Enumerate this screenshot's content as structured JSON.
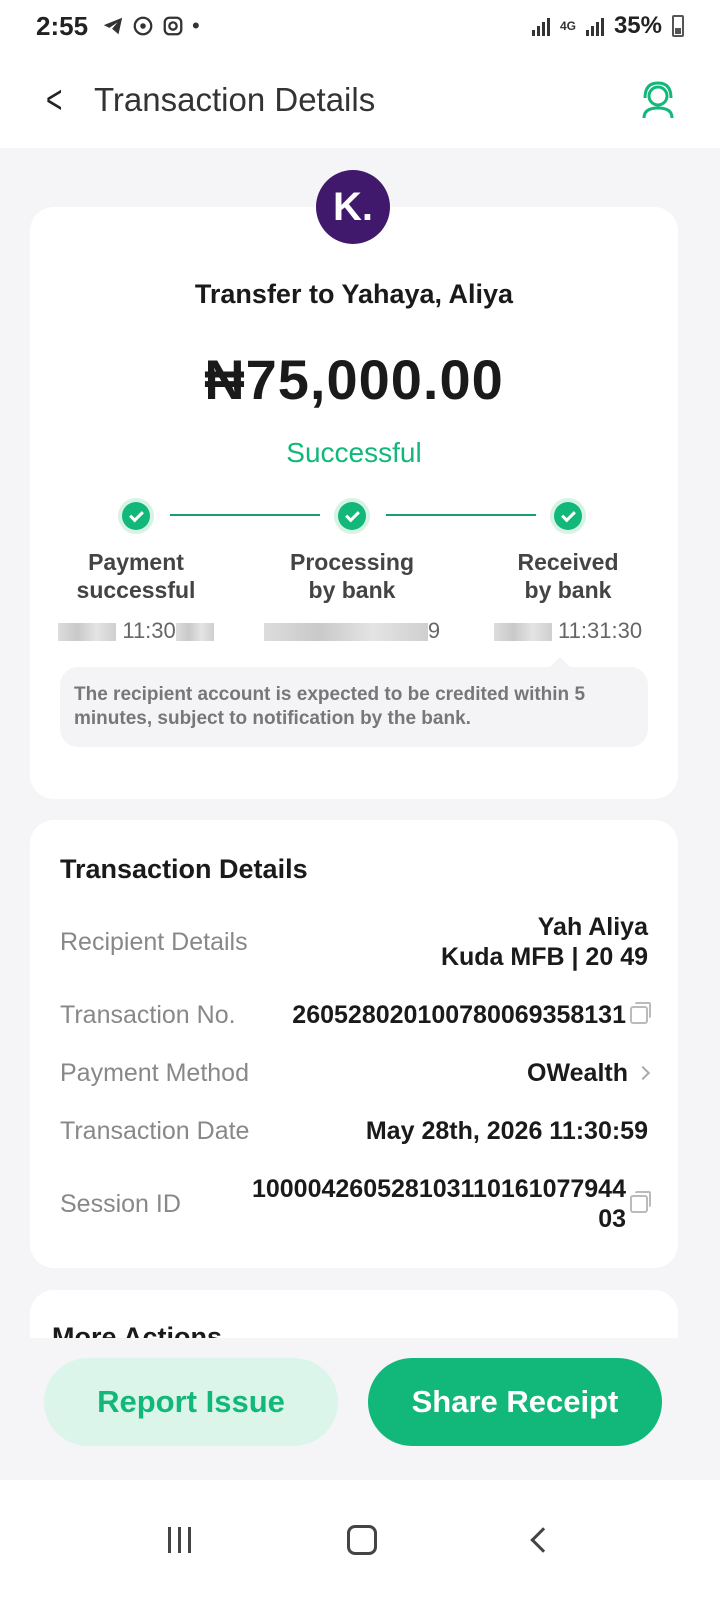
{
  "status_bar": {
    "time": "2:55",
    "network": "4G",
    "battery": "35%",
    "icons": [
      "telegram-icon",
      "whatsapp-icon",
      "instagram-icon",
      "dot-icon"
    ]
  },
  "header": {
    "title": "Transaction Details",
    "back_icon": "back-chevron-icon",
    "support_icon": "headset-support-icon"
  },
  "summary": {
    "logo_letter": "K.",
    "title": "Transfer to Yahaya, Aliya",
    "amount": "₦75,000.00",
    "status": "Successful",
    "steps": [
      {
        "label_line1": "Payment",
        "label_line2": "successful",
        "time": "11:30"
      },
      {
        "label_line1": "Processing",
        "label_line2": "by bank",
        "time": "9"
      },
      {
        "label_line1": "Received",
        "label_line2": "by bank",
        "time": "11:31:30"
      }
    ],
    "note": "The recipient account is expected to be credited within 5 minutes, subject to notification by the bank."
  },
  "details": {
    "title": "Transaction Details",
    "recipient_label": "Recipient Details",
    "recipient_name": "Yah Aliya",
    "recipient_bank": "Kuda MFB | 20 49",
    "txn_no_label": "Transaction No.",
    "txn_no": "260528020100780069358131",
    "method_label": "Payment Method",
    "method": "OWealth",
    "date_label": "Transaction Date",
    "date": "May 28th, 2026 11:30:59",
    "session_label": "Session ID",
    "session_line1": "100004260528103110161077944",
    "session_line2": "03"
  },
  "more_actions": {
    "title": "More Actions"
  },
  "actions": {
    "report": "Report Issue",
    "share": "Share Receipt"
  },
  "colors": {
    "accent": "#12b87a",
    "logo_bg": "#40196d"
  }
}
